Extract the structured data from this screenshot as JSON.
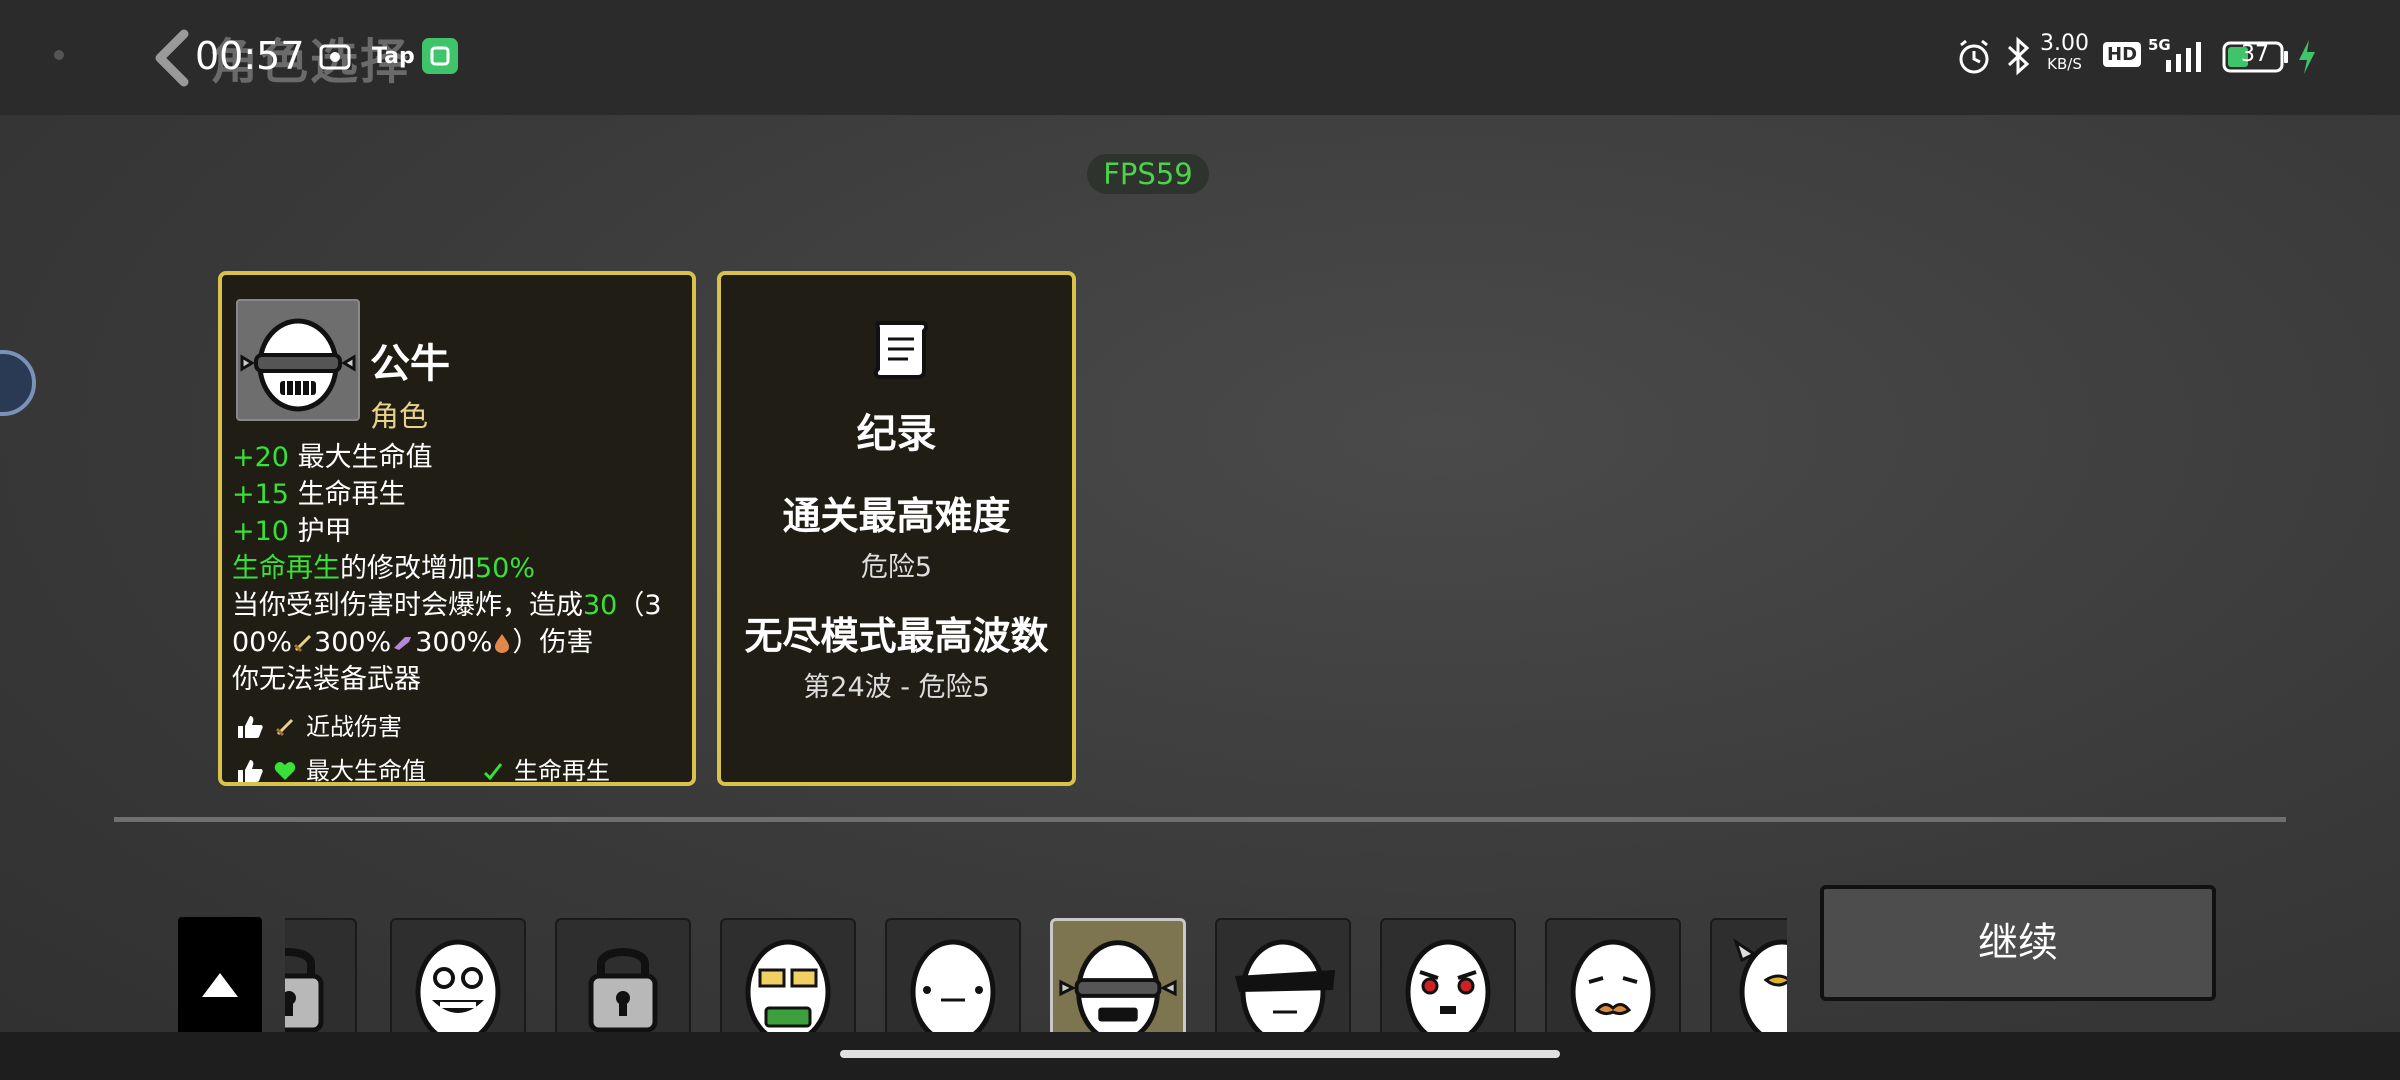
{
  "status_bar": {
    "time": "00:57",
    "tap_label": "Tap",
    "network_speed": "3.00",
    "network_unit": "KB/S",
    "hd_label": "HD",
    "signal_label": "5G",
    "battery": "37"
  },
  "header": {
    "title": "角色选择"
  },
  "fps": "FPS59",
  "character_card": {
    "name": "公牛",
    "type": "角色",
    "stats": [
      {
        "value": "+20",
        "text": " 最大生命值"
      },
      {
        "value": "+15",
        "text": " 生命再生"
      },
      {
        "value": "+10",
        "text": " 护甲"
      }
    ],
    "modifier": {
      "highlight": "生命再生",
      "text": "的修改增加",
      "value": "50%"
    },
    "explode_line1_a": "当你受到伤害时会爆炸，造成",
    "explode_value": "30",
    "explode_line1_b": "（3",
    "explode_line2": "00%",
    "explode_line2b": "300%",
    "explode_line2c": "300%",
    "explode_line2d": "）伤害",
    "no_weapon": "你无法装备武器",
    "tags": {
      "melee": "近战伤害",
      "max_hp": "最大生命值",
      "regen": "生命再生"
    }
  },
  "record_card": {
    "title": "纪录",
    "highest_difficulty_label": "通关最高难度",
    "highest_difficulty_value": "危险5",
    "endless_label": "无尽模式最高波数",
    "endless_value": "第24波 - 危险5"
  },
  "character_strip": {
    "slots": [
      "locked",
      "grin-glasses",
      "locked",
      "money-glasses",
      "neutral",
      "bull",
      "visor",
      "angry",
      "mustache",
      "partial"
    ],
    "selected_index": 5
  },
  "continue_button": "继续",
  "colors": {
    "card_border": "#d9c24a",
    "green_text": "#38e038",
    "fps_green": "#4bd44b"
  }
}
